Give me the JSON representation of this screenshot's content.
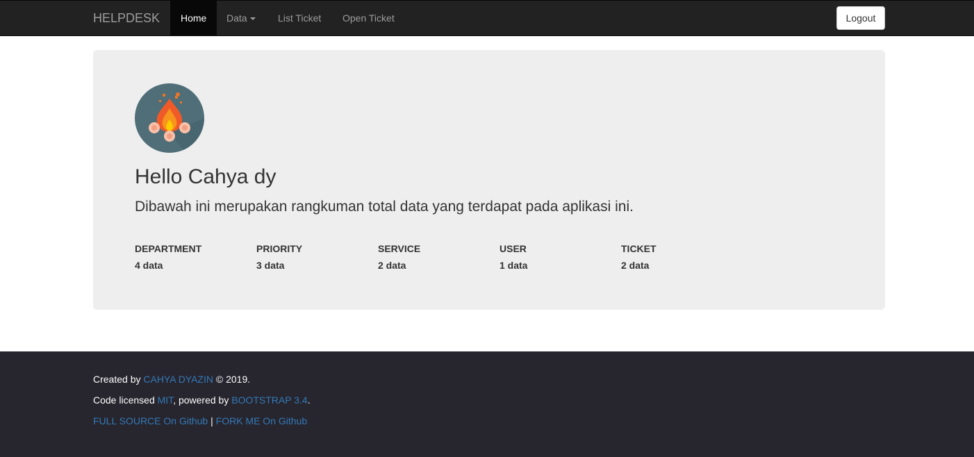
{
  "navbar": {
    "brand": "HELPDESK",
    "items": [
      {
        "label": "Home"
      },
      {
        "label": "Data"
      },
      {
        "label": "List Ticket"
      },
      {
        "label": "Open Ticket"
      }
    ],
    "logout_label": "Logout"
  },
  "jumbotron": {
    "greeting": "Hello Cahya dy",
    "lead": "Dibawah ini merupakan rangkuman total data yang terdapat pada aplikasi ini.",
    "avatar_icon": "campfire-icon",
    "stats": [
      {
        "label": "DEPARTMENT",
        "value": "4 data"
      },
      {
        "label": "PRIORITY",
        "value": "3 data"
      },
      {
        "label": "SERVICE",
        "value": "2 data"
      },
      {
        "label": "USER",
        "value": "1 data"
      },
      {
        "label": "TICKET",
        "value": "2 data"
      }
    ]
  },
  "footer": {
    "line1_prefix": "Created by ",
    "line1_link": "CAHYA DYAZIN",
    "line1_suffix": " © 2019.",
    "line2_prefix": "Code licensed ",
    "line2_link1": "MIT",
    "line2_mid": ", powered by ",
    "line2_link2": "BOOTSTRAP 3.4",
    "line2_suffix": ".",
    "line3_link1": "FULL SOURCE On Github",
    "line3_sep": " | ",
    "line3_link2": "FORK ME On Github"
  },
  "colors": {
    "navbar_bg": "#222222",
    "jumbotron_bg": "#eeeeee",
    "footer_bg": "#27252e",
    "link": "#337ab7"
  }
}
